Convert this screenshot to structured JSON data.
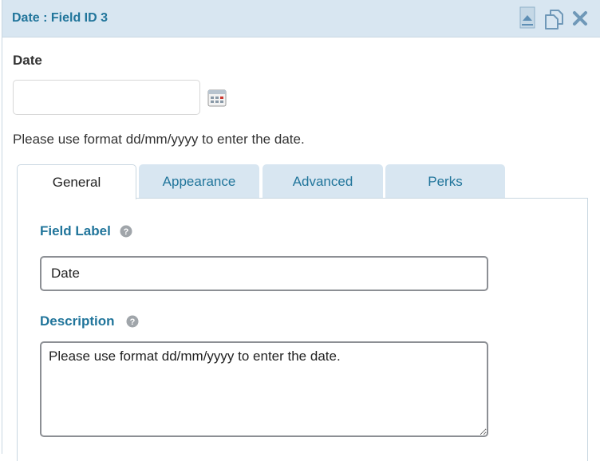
{
  "header": {
    "title": "Date : Field ID 3",
    "icons": [
      "collapse-icon",
      "duplicate-icon",
      "delete-icon"
    ]
  },
  "preview": {
    "label": "Date",
    "date_value": "",
    "calendar_icon": "calendar-icon",
    "description": "Please use format dd/mm/yyyy to enter the date."
  },
  "tabs": [
    {
      "label": "General",
      "active": true
    },
    {
      "label": "Appearance",
      "active": false
    },
    {
      "label": "Advanced",
      "active": false
    },
    {
      "label": "Perks",
      "active": false
    }
  ],
  "general": {
    "field_label": {
      "label": "Field Label",
      "value": "Date"
    },
    "description": {
      "label": "Description",
      "value": "Please use format dd/mm/yyyy to enter the date."
    },
    "help_icon": "help-icon"
  },
  "colors": {
    "accent": "#21759b",
    "header_bg": "#d8e6f1",
    "border": "#c9d7e1"
  }
}
